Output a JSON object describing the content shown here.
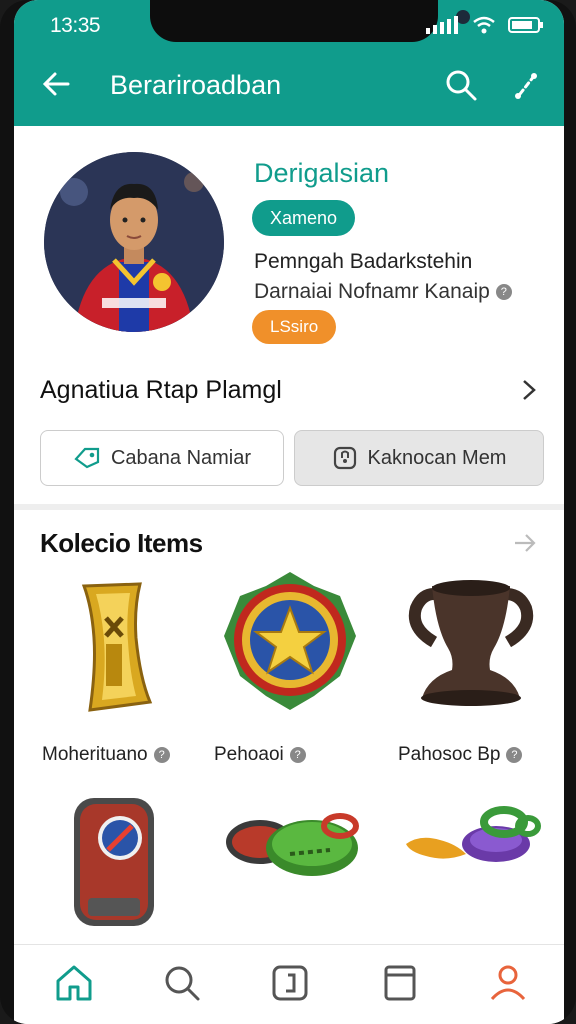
{
  "status": {
    "time": "13:35"
  },
  "appbar": {
    "title": "Berariroadban"
  },
  "profile": {
    "name": "Derigalsian",
    "tag": "Xameno",
    "line1": "Pemngah Badarkstehin",
    "line2": "Darnaiai Nofnamr Kanaip",
    "tag2": "LSsiro"
  },
  "row": {
    "label": "Agnatiua Rtap Plamgl"
  },
  "buttons": {
    "left": "Cabana Namiar",
    "right": "Kaknocan Mem"
  },
  "section": {
    "title": "Kolecio Items"
  },
  "items": [
    {
      "label": "Moherituano"
    },
    {
      "label": "Pehoaoi"
    },
    {
      "label": "Pahosoc Bp"
    }
  ],
  "colors": {
    "primary": "#109c8c",
    "accent": "#f0902a",
    "nav_active": "#e8643c"
  },
  "nav": [
    "home-icon",
    "search-icon",
    "collection-icon",
    "book-icon",
    "profile-icon"
  ]
}
